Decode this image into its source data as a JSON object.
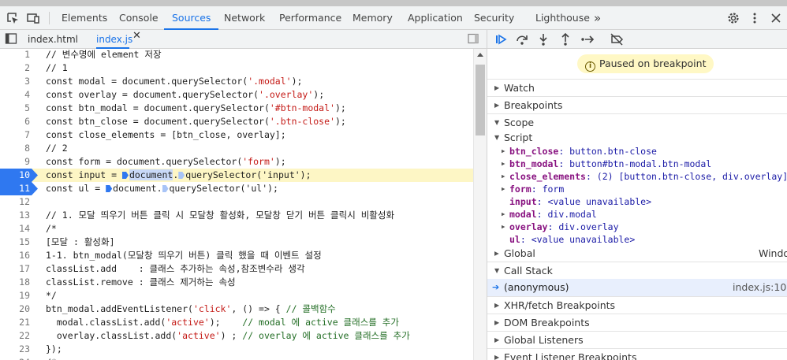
{
  "devtools_tabs": [
    "Elements",
    "Console",
    "Sources",
    "Network",
    "Performance",
    "Memory",
    "Application",
    "Security",
    "Lighthouse"
  ],
  "more_tabs": "»",
  "files": {
    "tab1": "index.html",
    "tab2": "index.js",
    "close": "✕"
  },
  "code": [
    {
      "n": "1",
      "t": "// 변수명에 element 저장"
    },
    {
      "n": "2",
      "t": "// 1"
    },
    {
      "n": "3",
      "t": "const modal = document.querySelector('.modal');"
    },
    {
      "n": "4",
      "t": "const overlay = document.querySelector('.overlay');"
    },
    {
      "n": "5",
      "t": "const btn_modal = document.querySelector('#btn-modal');"
    },
    {
      "n": "6",
      "t": "const btn_close = document.querySelector('.btn-close');"
    },
    {
      "n": "7",
      "t": "const close_elements = [btn_close, overlay];"
    },
    {
      "n": "8",
      "t": "// 2"
    },
    {
      "n": "9",
      "t": "const form = document.querySelector('form');"
    },
    {
      "n": "10",
      "t": "const input = document.querySelector('input');"
    },
    {
      "n": "11",
      "t": "const ul = document.querySelector('ul');"
    },
    {
      "n": "12",
      "t": ""
    },
    {
      "n": "13",
      "t": "// 1. 모달 띄우기 버튼 클릭 시 모달창 활성화, 모달창 닫기 버튼 클릭시 비활성화"
    },
    {
      "n": "14",
      "t": "/*"
    },
    {
      "n": "15",
      "t": "[모달 : 활성화]"
    },
    {
      "n": "16",
      "t": "1-1. btn_modal(모달창 띄우기 버튼) 클릭 했을 때 이벤트 설정"
    },
    {
      "n": "17",
      "t": "classList.add    : 클래스 추가하는 속성,참조변수라 생각"
    },
    {
      "n": "18",
      "t": "classList.remove : 클래스 제거하는 속성"
    },
    {
      "n": "19",
      "t": "*/"
    },
    {
      "n": "20",
      "t": "btn_modal.addEventListener('click', () => { // 콜백함수"
    },
    {
      "n": "21",
      "t": "  modal.classList.add('active');    // modal 에 active 클래스를 추가"
    },
    {
      "n": "22",
      "t": "  overlay.classList.add('active') ; // overlay 에 active 클래스를 추가"
    },
    {
      "n": "23",
      "t": "});"
    },
    {
      "n": "24",
      "t": "/*"
    }
  ],
  "paused_text": "Paused on breakpoint",
  "sections": {
    "watch": "Watch",
    "breakpoints": "Breakpoints",
    "scope": "Scope",
    "script": "Script",
    "global": "Global",
    "global_value": "Window",
    "call_stack": "Call Stack",
    "xhr": "XHR/fetch Breakpoints",
    "dom": "DOM Breakpoints",
    "global_listeners": "Global Listeners",
    "event_listeners": "Event Listener Breakpoints"
  },
  "scope_vars": [
    {
      "k": "btn_close",
      "v": "button.btn-close"
    },
    {
      "k": "btn_modal",
      "v": "button#btn-modal.btn-modal"
    },
    {
      "k": "close_elements",
      "v": "(2) [button.btn-close, div.overlay]"
    },
    {
      "k": "form",
      "v": "form"
    },
    {
      "k": "input",
      "v": "<value unavailable>"
    },
    {
      "k": "modal",
      "v": "div.modal"
    },
    {
      "k": "overlay",
      "v": "div.overlay"
    },
    {
      "k": "ul",
      "v": "<value unavailable>"
    }
  ],
  "call_stack": {
    "frame": "(anonymous)",
    "location": "index.js:10"
  }
}
